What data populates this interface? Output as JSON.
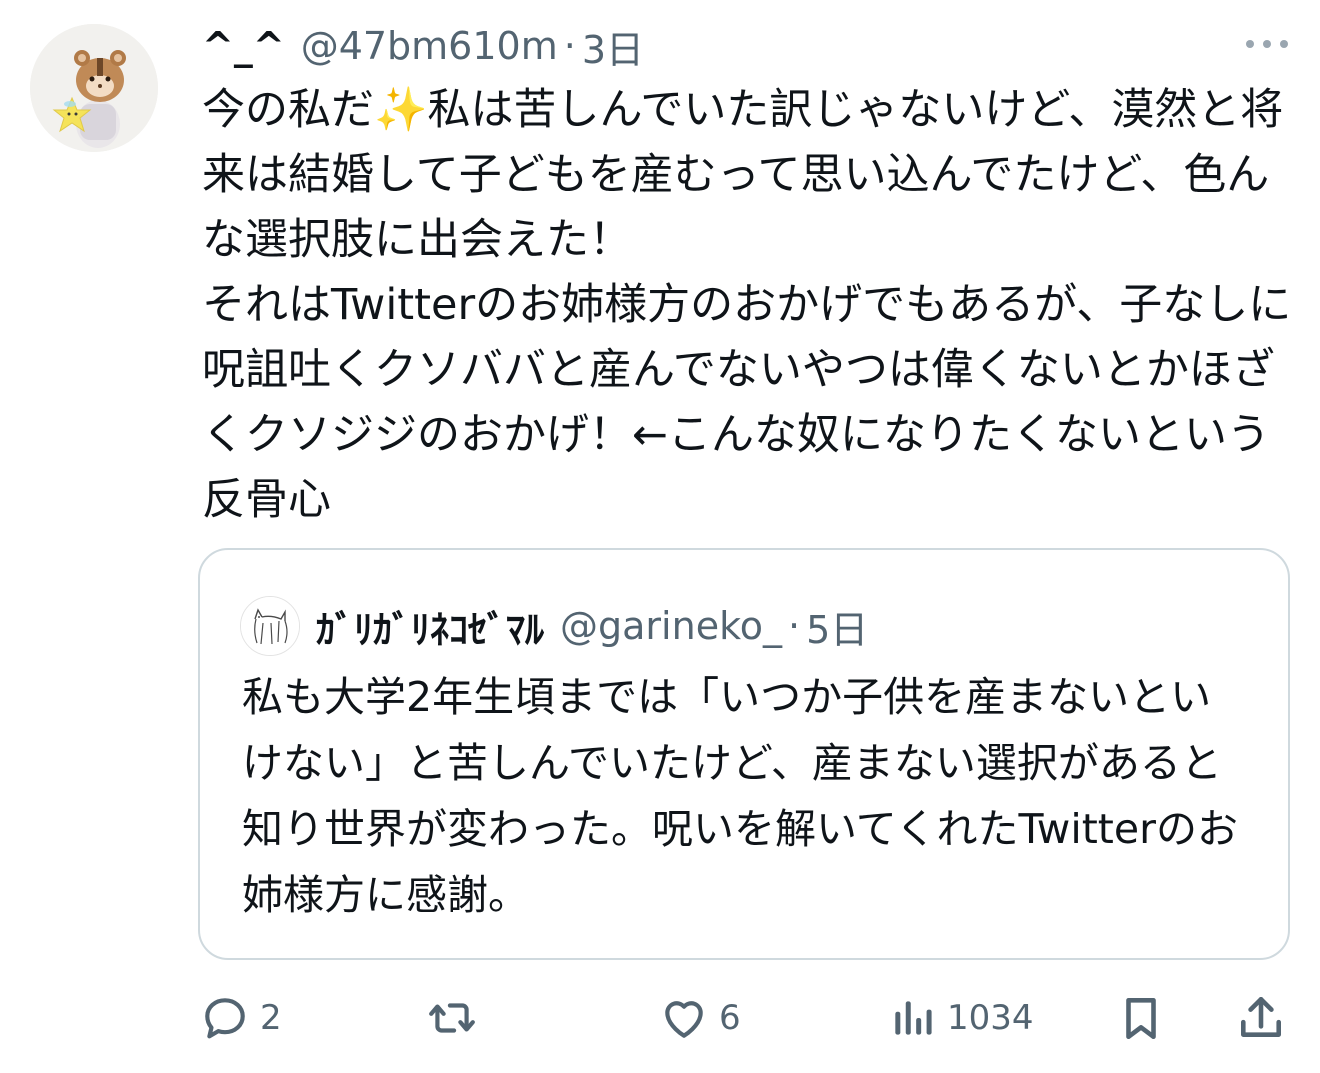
{
  "tweet": {
    "display_name": "^_^",
    "handle": "@47bm610m",
    "separator": "·",
    "time": "3日",
    "avatar_icon": "squirrel-doll-avatar",
    "text": "今の私だ✨私は苦しんでいた訳じゃないけど、漠然と将来は結婚して子どもを産むって思い込んでたけど、色んな選択肢に出会えた！\nそれはTwitterのお姉様方のおかげでもあるが、子なしに呪詛吐くクソババと産んでないやつは偉くないとかほざくクソジジのおかげ！←こんな奴になりたくないという反骨心"
  },
  "quote": {
    "display_name": "ｶﾞﾘｶﾞﾘﾈｺｾﾞﾏﾙ",
    "handle": "@garineko_",
    "separator": "·",
    "time": "5日",
    "avatar_icon": "cat-drawing-avatar",
    "text": "私も大学2年生頃までは「いつか子供を産まないといけない」と苦しんでいたけど、産まない選択があると知り世界が変わった。呪いを解いてくれたTwitterのお姉様方に感謝。"
  },
  "actions": {
    "reply_count": "2",
    "retweet_count": "",
    "like_count": "6",
    "views_count": "1034"
  },
  "colors": {
    "text": "#0f1419",
    "secondary": "#536471",
    "border": "#cfd9de"
  }
}
